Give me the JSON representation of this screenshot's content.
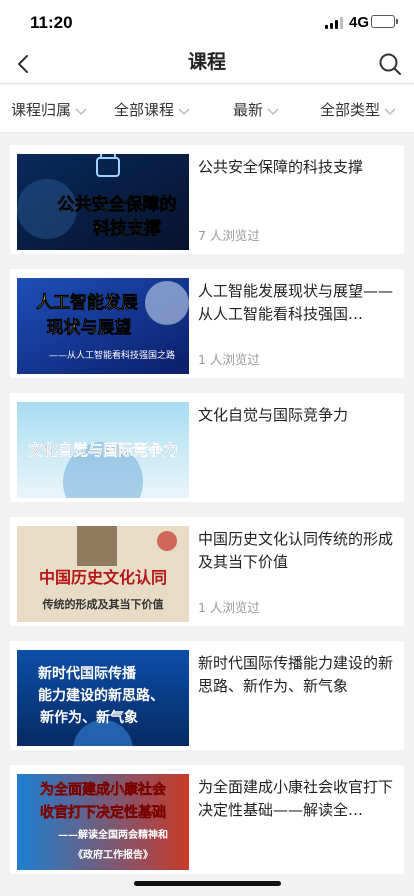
{
  "status": {
    "time": "11:20",
    "network": "4G"
  },
  "nav": {
    "title": "课程"
  },
  "filters": [
    "课程归属",
    "全部课程",
    "最新",
    "全部类型"
  ],
  "courses": [
    {
      "title": "公共安全保障的科技支撑",
      "views": "7 人浏览过",
      "thumb_lines": [
        "公共安全保障的",
        "科技支撑"
      ]
    },
    {
      "title": "人工智能发展现状与展望——从人工智能看科技强国…",
      "views": "1 人浏览过",
      "thumb_lines": [
        "人工智能发展",
        "现状与展望",
        "——从人工智能看科技强国之路"
      ]
    },
    {
      "title": "文化自觉与国际竞争力",
      "views": "",
      "thumb_lines": [
        "文化自觉与国际竞争力"
      ]
    },
    {
      "title": "中国历史文化认同传统的形成及其当下价值",
      "views": "1 人浏览过",
      "thumb_lines": [
        "中国历史文化认同",
        "传统的形成及其当下价值"
      ]
    },
    {
      "title": "新时代国际传播能力建设的新思路、新作为、新气象",
      "views": "",
      "thumb_lines": [
        "新时代国际传播",
        "能力建设的新思路、",
        "新作为、新气象"
      ]
    },
    {
      "title": "为全面建成小康社会收官打下决定性基础——解读全…",
      "views": "",
      "thumb_lines": [
        "为全面建成小康社会",
        "收官打下决定性基础",
        "——解读全国两会精神和",
        "《政府工作报告》"
      ]
    }
  ]
}
